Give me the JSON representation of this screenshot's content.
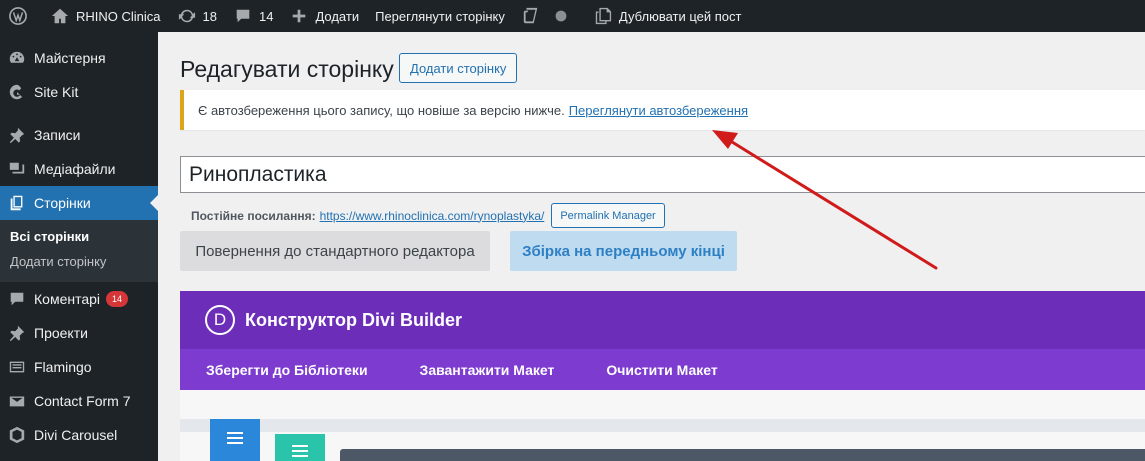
{
  "adminbar": {
    "site_name": "RHINO Clinica",
    "updates_count": "18",
    "comments_count": "14",
    "new_label": "Додати",
    "view_label": "Переглянути сторінку",
    "duplicate_label": "Дублювати цей пост"
  },
  "sidebar": {
    "items": [
      {
        "label": "Майстерня"
      },
      {
        "label": "Site Kit"
      },
      {
        "label": "Записи"
      },
      {
        "label": "Медіафайли"
      },
      {
        "label": "Сторінки"
      },
      {
        "label": "Коментарі",
        "badge": "14"
      },
      {
        "label": "Проекти"
      },
      {
        "label": "Flamingo"
      },
      {
        "label": "Contact Form 7"
      },
      {
        "label": "Divi Carousel"
      }
    ],
    "submenu": [
      "Всі сторінки",
      "Додати сторінку"
    ]
  },
  "main": {
    "page_title": "Редагувати сторінку",
    "add_page_button": "Додати сторінку",
    "notice_text": "Є автозбереження цього запису, що новіше за версію нижче.",
    "notice_link": "Переглянути автозбереження",
    "post_title": "Ринопластика",
    "permalink_label": "Постійне посилання:",
    "permalink_url": "https://www.rhinoclinica.com/rynoplastyka/",
    "permalink_manager": "Permalink Manager",
    "standard_editor_button": "Повернення до стандартного редактора",
    "visual_builder_button": "Збірка на передньому кінці"
  },
  "divi": {
    "logo_letter": "D",
    "title": "Конструктор Divi Builder",
    "tools": [
      "Зберегти до Бібліотеки",
      "Завантажити Макет",
      "Очистити Макет"
    ]
  },
  "colors": {
    "admin_dark": "#1d2327",
    "accent_blue": "#2271b1",
    "notice_warning": "#dba617",
    "divi_purple": "#6c2eb9",
    "divi_purple_light": "#7d3bcf",
    "arrow_red": "#d11b1b"
  }
}
